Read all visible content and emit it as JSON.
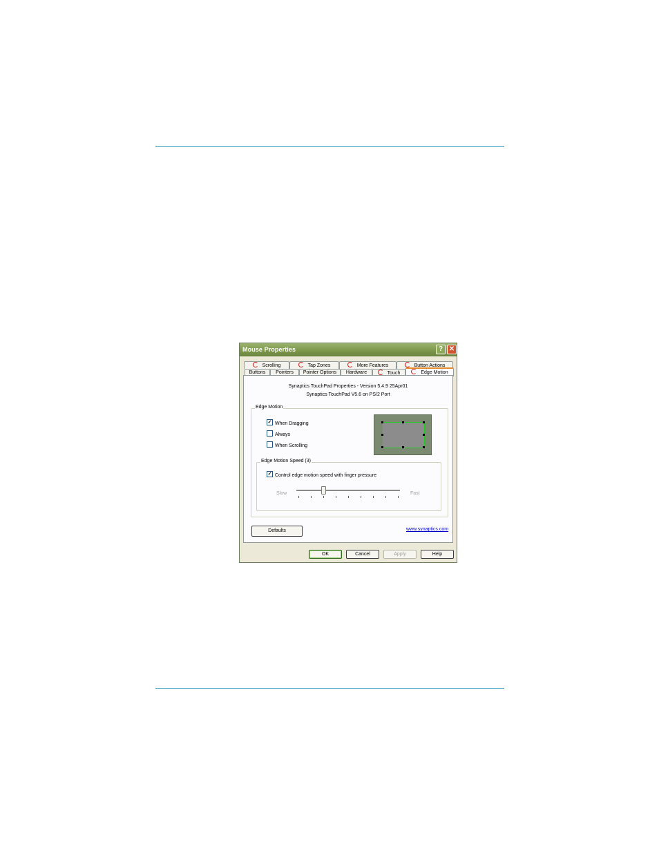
{
  "window": {
    "title": "Mouse Properties",
    "help_glyph": "?",
    "close_glyph": "✕"
  },
  "tabs_row1": [
    {
      "label": "Scrolling",
      "icon": "synaptics-icon"
    },
    {
      "label": "Tap Zones",
      "icon": "synaptics-icon"
    },
    {
      "label": "More Features",
      "icon": "synaptics-icon"
    },
    {
      "label": "Button Actions",
      "icon": "synaptics-icon"
    }
  ],
  "tabs_row2": [
    {
      "label": "Buttons"
    },
    {
      "label": "Pointers"
    },
    {
      "label": "Pointer Options"
    },
    {
      "label": "Hardware"
    },
    {
      "label": "Touch",
      "icon": "synaptics-icon"
    },
    {
      "label": "Edge Motion",
      "icon": "synaptics-icon",
      "active": true
    }
  ],
  "info": {
    "line1": "Synaptics TouchPad Properties - Version 5.4.9 25Apr01",
    "line2": "Synaptics TouchPad V5.6 on PS/2 Port"
  },
  "edge_motion": {
    "group_label": "Edge Motion",
    "options": [
      {
        "label": "When Dragging",
        "checked": true
      },
      {
        "label": "Always",
        "checked": false
      },
      {
        "label": "When Scrolling",
        "checked": false
      }
    ]
  },
  "speed": {
    "group_label": "Edge Motion Speed (3)",
    "checkbox_label": "Control edge motion speed with finger pressure",
    "checked": true,
    "slow_label": "Slow",
    "fast_label": "Fast",
    "value": 3,
    "min": 1,
    "max": 9
  },
  "buttons": {
    "defaults": "Defaults",
    "link": "www.synaptics.com",
    "ok": "OK",
    "cancel": "Cancel",
    "apply": "Apply",
    "help": "Help"
  }
}
